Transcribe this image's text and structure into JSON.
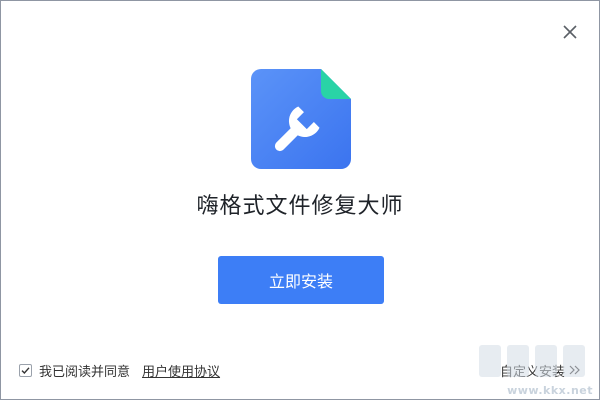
{
  "window": {
    "close_icon": "close-icon"
  },
  "app": {
    "logo_icon": "document-wrench-icon",
    "title": "嗨格式文件修复大师"
  },
  "install": {
    "button_label": "立即安装"
  },
  "agreement": {
    "checked": true,
    "text": "我已阅读并同意",
    "link_label": "用户使用协议"
  },
  "custom_install": {
    "label": "自定义安装",
    "icon": "double-chevron-right-icon"
  },
  "watermark": {
    "text": "www.kkx.net"
  },
  "colors": {
    "primary": "#3d7ef6",
    "logo_blue": "#4f86f7",
    "logo_corner": "#29d3a6",
    "text": "#1f2329"
  }
}
